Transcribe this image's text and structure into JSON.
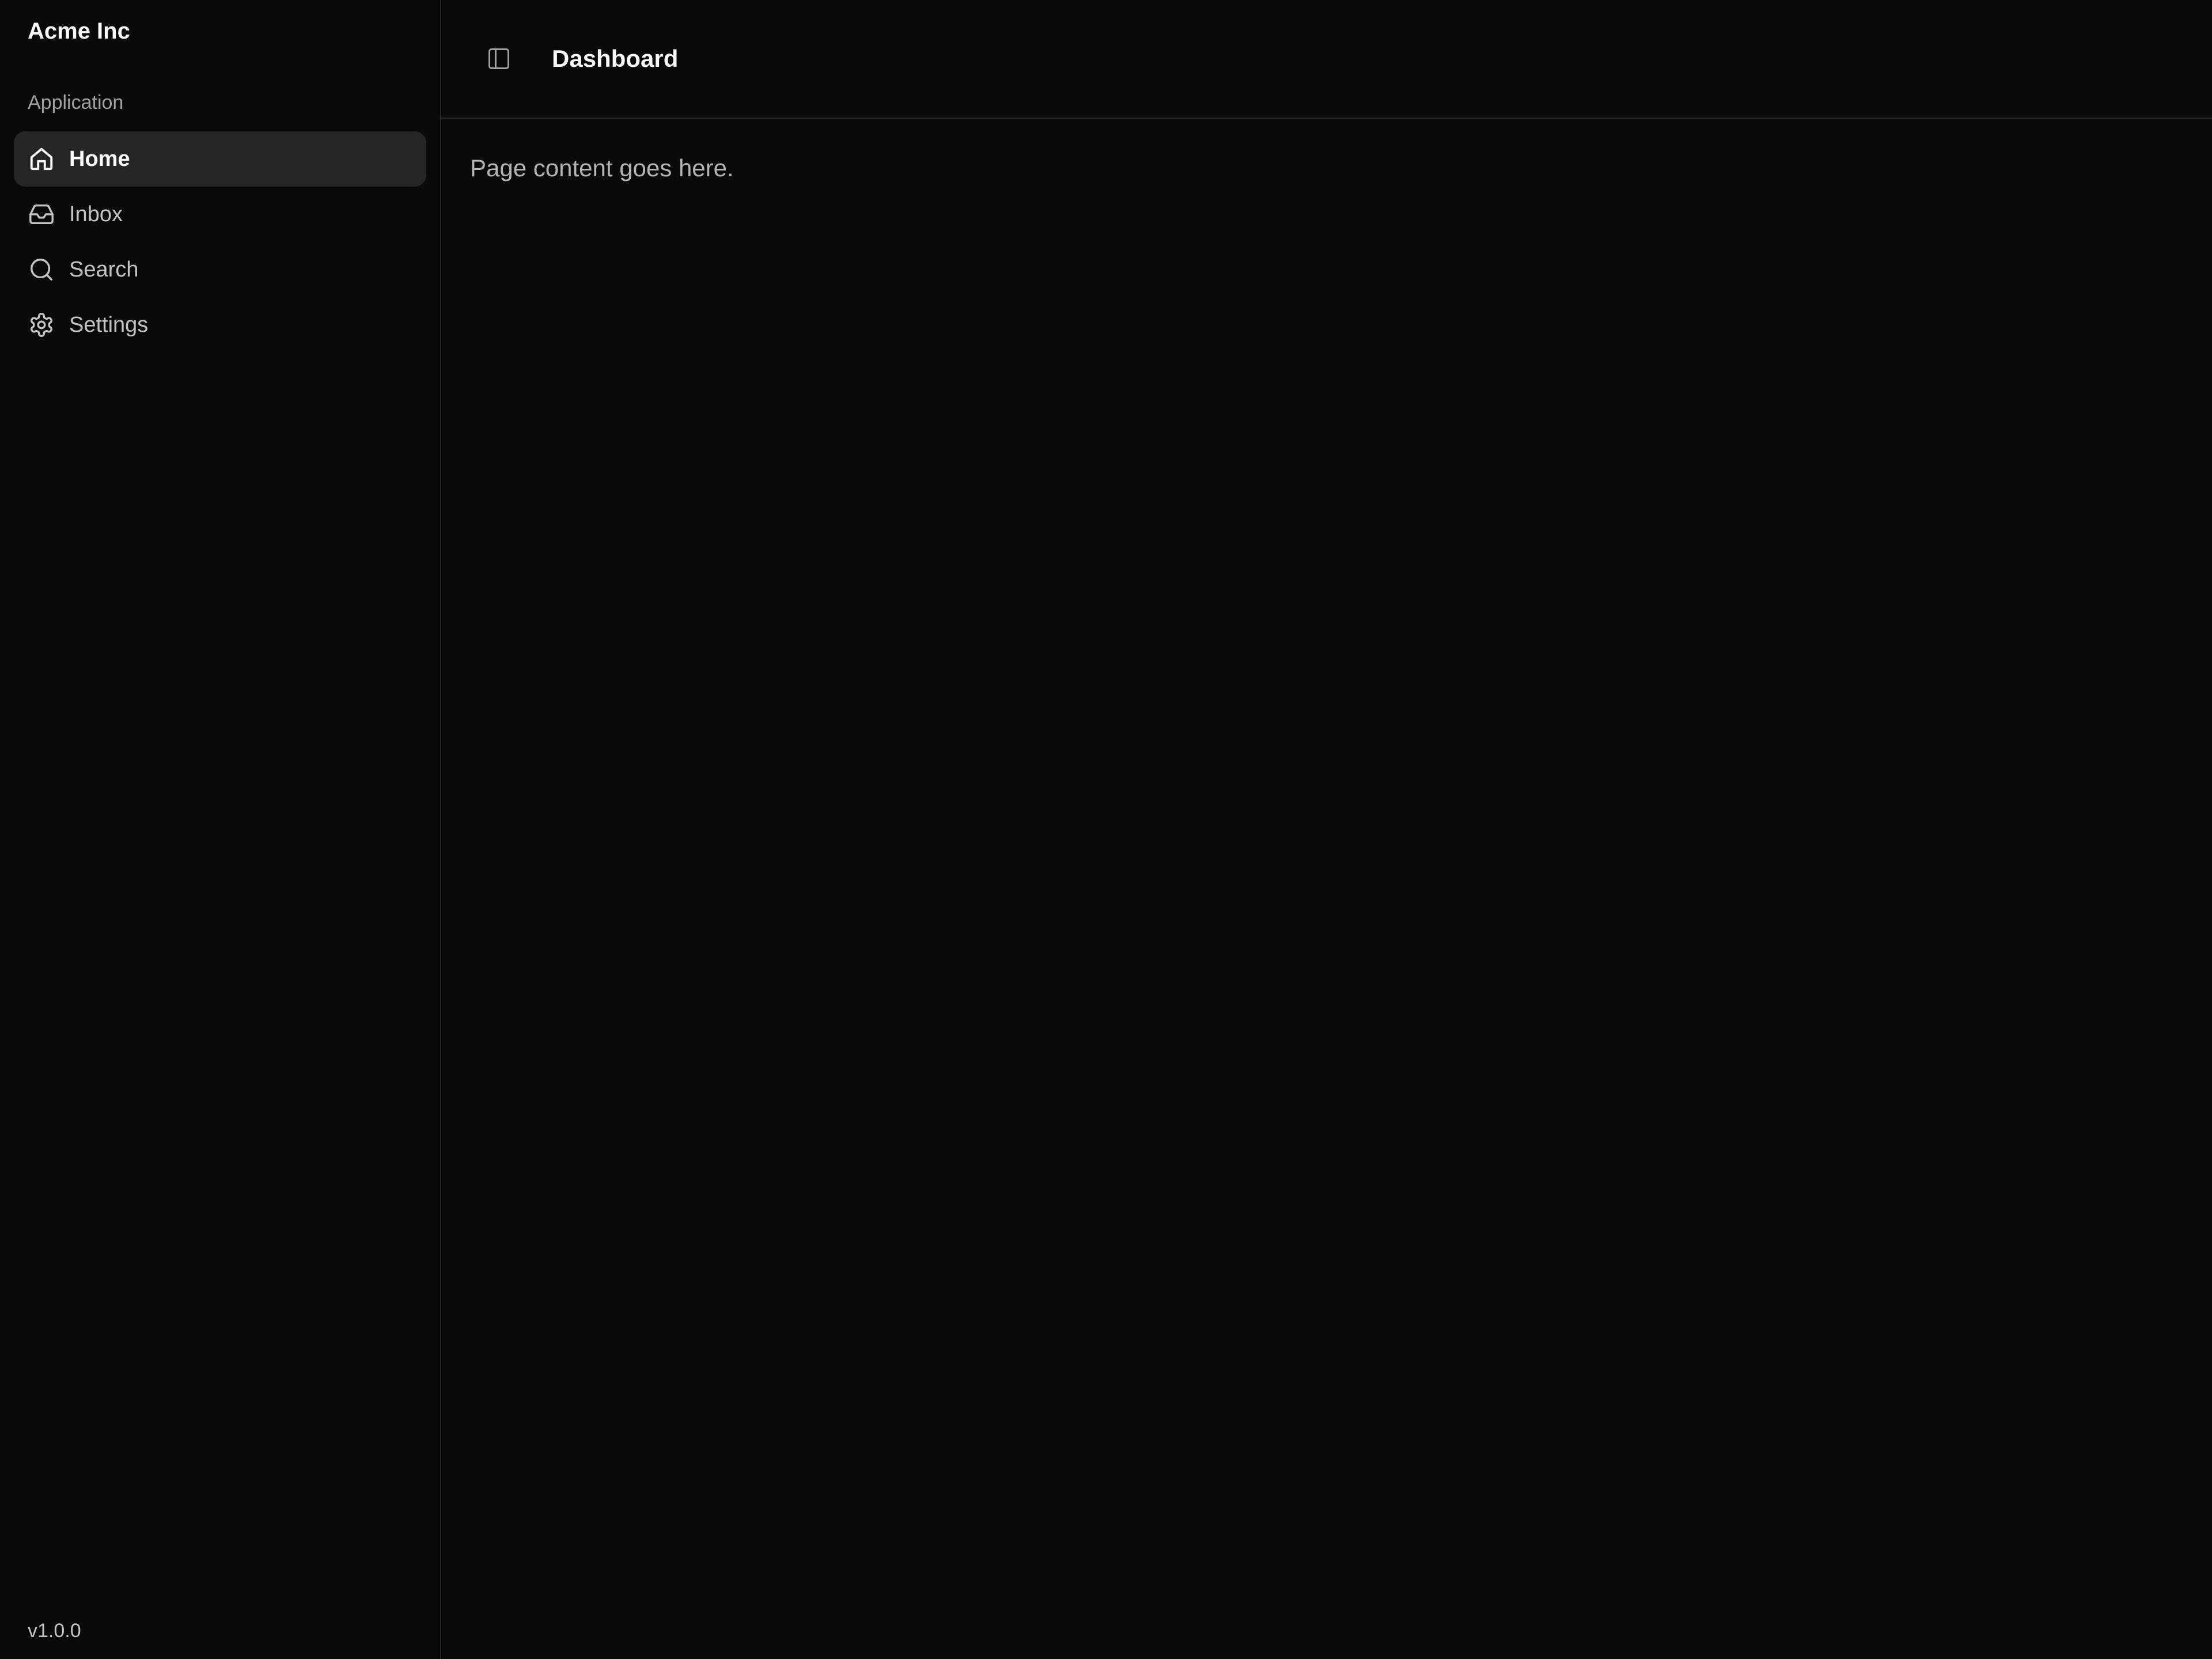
{
  "sidebar": {
    "brand": "Acme Inc",
    "group_label": "Application",
    "items": [
      {
        "label": "Home",
        "icon": "home-icon",
        "active": true
      },
      {
        "label": "Inbox",
        "icon": "inbox-icon",
        "active": false
      },
      {
        "label": "Search",
        "icon": "search-icon",
        "active": false
      },
      {
        "label": "Settings",
        "icon": "gear-icon",
        "active": false
      }
    ],
    "version": "v1.0.0"
  },
  "header": {
    "toggle_icon": "sidebar-toggle-icon",
    "title": "Dashboard"
  },
  "main": {
    "content_text": "Page content goes here."
  },
  "colors": {
    "background": "#0a0a0a",
    "active_item_bg": "#262626",
    "border": "#262626",
    "muted_text": "#a1a1a1"
  }
}
